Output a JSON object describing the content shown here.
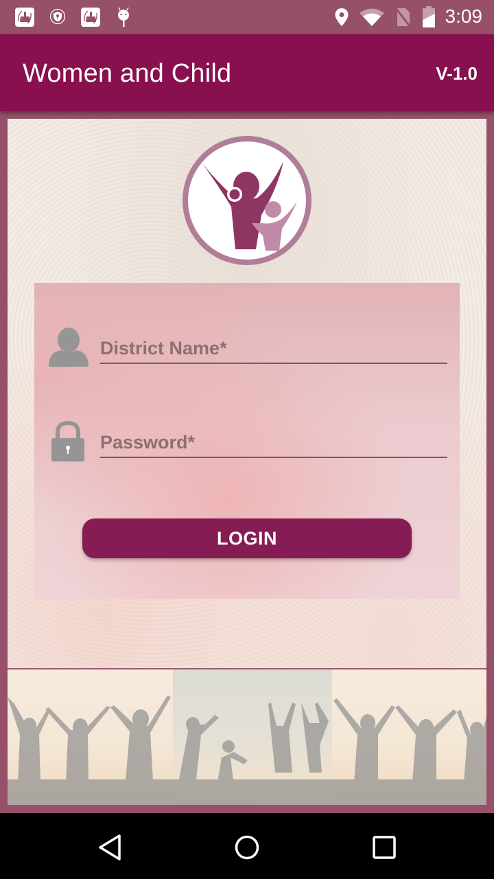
{
  "status_bar": {
    "time": "3:09",
    "left_icons": [
      "cleaner-app-icon",
      "vpn-shield-icon",
      "cleaner-app-icon",
      "android-debug-icon"
    ],
    "right_icons": [
      "location-icon",
      "wifi-icon",
      "no-sim-icon",
      "battery-charging-icon"
    ]
  },
  "app_bar": {
    "title": "Women and Child",
    "version": "V-1.0"
  },
  "login_form": {
    "district_field": {
      "icon": "user-icon",
      "value": "",
      "placeholder": "District Name*"
    },
    "password_field": {
      "icon": "lock-icon",
      "value": "",
      "placeholder": "Password*"
    },
    "login_button_label": "LOGIN"
  },
  "colors": {
    "primary": "#88104e",
    "status_bar": "#965069",
    "button": "#851d54",
    "logo_dark": "#8e3563",
    "logo_light": "#c28aa8",
    "logo_ring": "#b07e98"
  },
  "nav_bar": {
    "buttons": [
      "back-icon",
      "home-icon",
      "recents-icon"
    ]
  }
}
